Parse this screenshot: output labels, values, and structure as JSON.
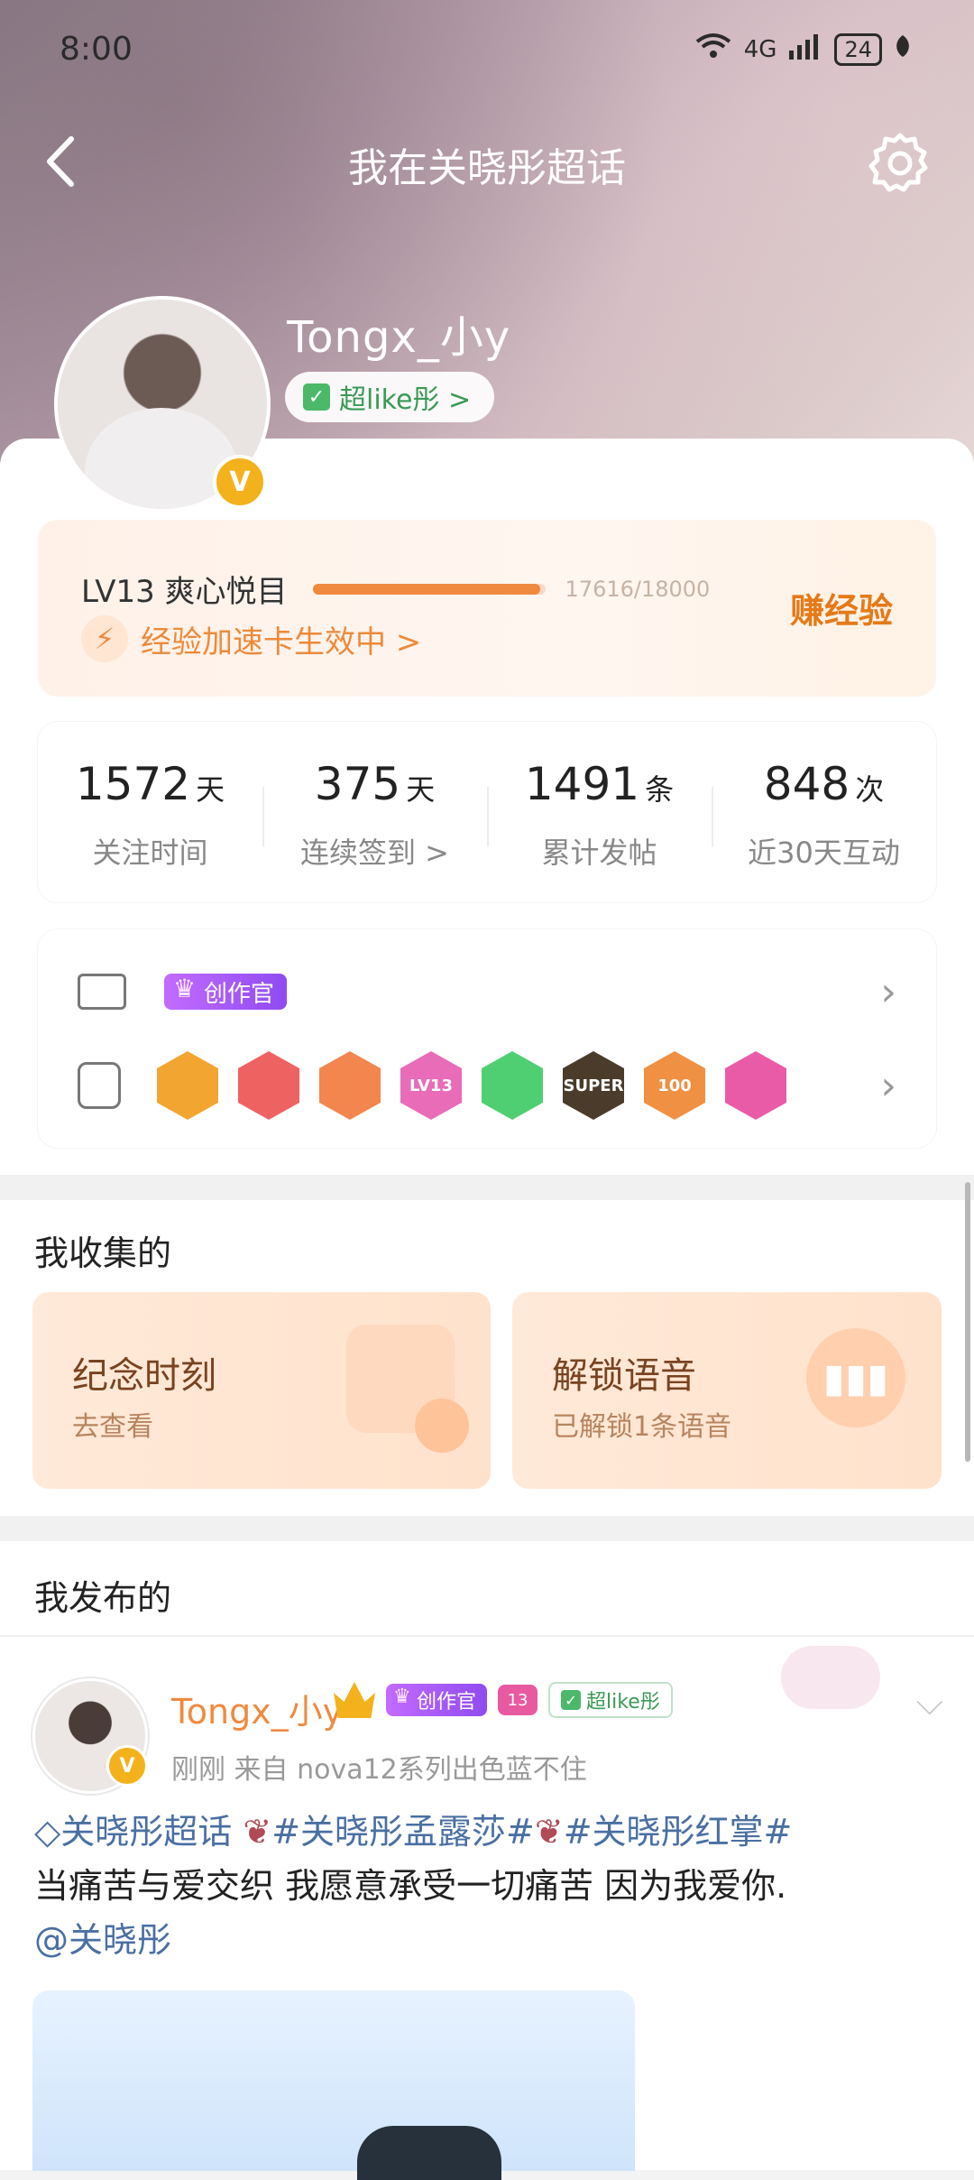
{
  "status_bar": {
    "time": "8:00",
    "network": "4G",
    "battery": "24"
  },
  "title_bar": {
    "title": "我在关晓彤超话"
  },
  "profile": {
    "username": "Tongx_小y",
    "super_like_label": "超like彤 >"
  },
  "level": {
    "label": "LV13 爽心悦目",
    "progress": 0.978,
    "progress_text": "17616/18000",
    "boost_label": "经验加速卡生效中 >",
    "earn_label": "赚经验"
  },
  "stats": [
    {
      "num": "1572",
      "unit": "天",
      "label": "关注时间"
    },
    {
      "num": "375",
      "unit": "天",
      "label": "连续签到 >"
    },
    {
      "num": "1491",
      "unit": "条",
      "label": "累计发帖"
    },
    {
      "num": "848",
      "unit": "次",
      "label": "近30天互动"
    }
  ],
  "badges": {
    "creator_label": "创作官",
    "items": [
      {
        "name": "crown-badge",
        "color": "#f3a531",
        "text": ""
      },
      {
        "name": "trophy-badge",
        "color": "#ef6262",
        "text": ""
      },
      {
        "name": "mascot-badge",
        "color": "#f2864e",
        "text": ""
      },
      {
        "name": "lv13-badge",
        "color": "#e96cb8",
        "text": "LV13"
      },
      {
        "name": "clap-badge",
        "color": "#4fcf72",
        "text": ""
      },
      {
        "name": "super-badge",
        "color": "#4a3b2b",
        "text": "SUPER"
      },
      {
        "name": "100-days-badge",
        "color": "#f09043",
        "text": "100"
      },
      {
        "name": "graduate-badge",
        "color": "#ea5ba7",
        "text": ""
      }
    ]
  },
  "collection": {
    "title": "我收集的",
    "cards": [
      {
        "title": "纪念时刻",
        "subtitle": "去查看"
      },
      {
        "title": "解锁语音",
        "subtitle": "已解锁1条语音"
      }
    ]
  },
  "posts": {
    "title": "我发布的",
    "item": {
      "name": "Tongx_小y",
      "creator_tag": "创作官",
      "level": "13",
      "like_tag": "超like彤",
      "meta": "刚刚  来自 nova12系列出色蓝不住",
      "tag1": "关晓彤超话",
      "tag2": "#关晓彤孟露莎#",
      "tag3": "#关晓彤红掌#",
      "body": "当痛苦与爱交织 我愿意承受一切痛苦 因为我爱你.",
      "mention": "@关晓彤"
    }
  },
  "colors": {
    "accent": "#f08a3f",
    "green": "#3b9a56",
    "purple": "#9b56f3",
    "link": "#4a6fa3"
  }
}
